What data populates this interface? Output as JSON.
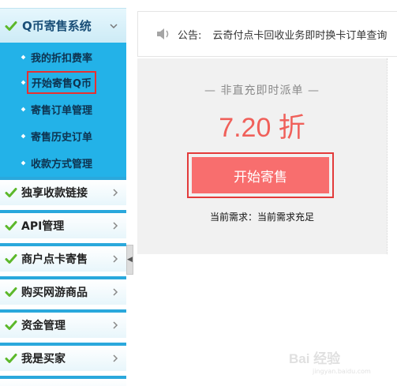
{
  "sidebar": {
    "header": {
      "label": "Q币寄售系统",
      "icon": "check-icon",
      "state": "expanded"
    },
    "submenu": [
      {
        "label": "我的折扣费率",
        "active": false
      },
      {
        "label": "开始寄售Q币",
        "active": true
      },
      {
        "label": "寄售订单管理",
        "active": false
      },
      {
        "label": "寄售历史订单",
        "active": false
      },
      {
        "label": "收款方式管理",
        "active": false
      }
    ],
    "items": [
      {
        "label": "独享收款链接"
      },
      {
        "label": "API管理"
      },
      {
        "label": "商户点卡寄售"
      },
      {
        "label": "购买网游商品"
      },
      {
        "label": "资金管理"
      },
      {
        "label": "我是买家"
      }
    ],
    "colors": {
      "accent": "#23b2e8",
      "check": "#5cb82a",
      "active_outline": "#e83030"
    }
  },
  "notice": {
    "label": "公告:",
    "text": "云奇付点卡回收业务即时换卡订单查询",
    "icon": "speaker-icon"
  },
  "panel": {
    "title": "— 非直充即时派单 —",
    "discount": "7.20 折",
    "button_label": "开始寄售",
    "demand": "当前需求：当前需求充足",
    "colors": {
      "discount": "#f0605a",
      "button": "#f86e6e",
      "button_outline": "#e33b3b"
    }
  },
  "watermark": {
    "text": "Bai 经验",
    "url": "jingyan.baidu.com"
  }
}
